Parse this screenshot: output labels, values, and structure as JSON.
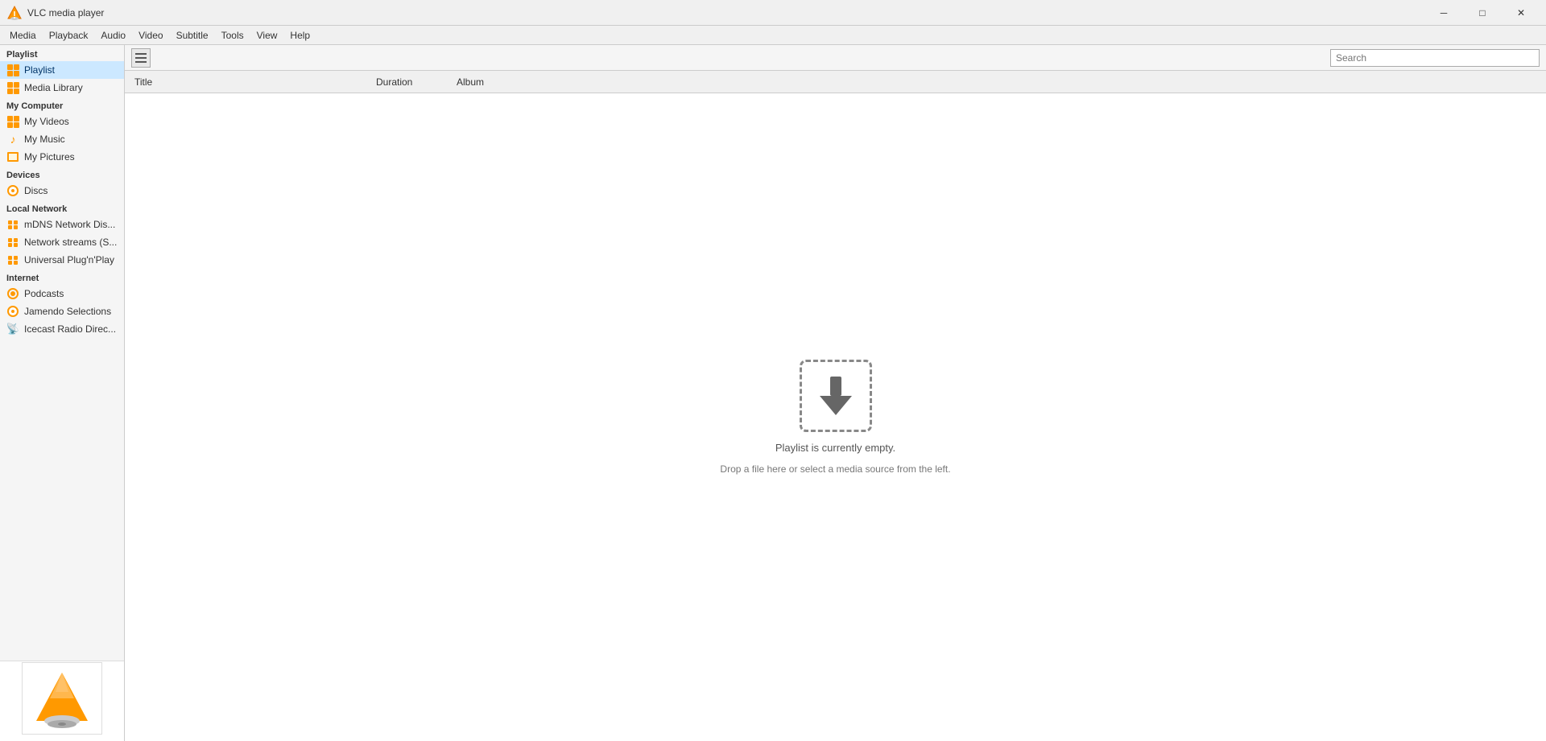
{
  "window": {
    "title": "VLC media player",
    "min_btn": "─",
    "max_btn": "□",
    "close_btn": "✕"
  },
  "menu": {
    "items": [
      "Media",
      "Playback",
      "Audio",
      "Video",
      "Subtitle",
      "Tools",
      "View",
      "Help"
    ]
  },
  "toolbar": {
    "view_icon": "☰",
    "search_placeholder": "Search"
  },
  "columns": {
    "title": "Title",
    "duration": "Duration",
    "album": "Album"
  },
  "sidebar": {
    "playlist_label": "Playlist",
    "playlist_item": "Playlist",
    "media_library_item": "Media Library",
    "my_computer_label": "My Computer",
    "my_videos_item": "My Videos",
    "my_music_item": "My Music",
    "my_pictures_item": "My Pictures",
    "devices_label": "Devices",
    "discs_item": "Discs",
    "local_network_label": "Local Network",
    "mdns_item": "mDNS Network Dis...",
    "network_streams_item": "Network streams (S...",
    "universal_plug_item": "Universal Plug'n'Play",
    "internet_label": "Internet",
    "podcasts_item": "Podcasts",
    "jamendo_item": "Jamendo Selections",
    "icecast_item": "Icecast Radio Direc..."
  },
  "empty_state": {
    "primary": "Playlist is currently empty.",
    "secondary": "Drop a file here or select a media source from the left."
  },
  "thumbnail": {
    "alt": "VLC media player logo"
  }
}
